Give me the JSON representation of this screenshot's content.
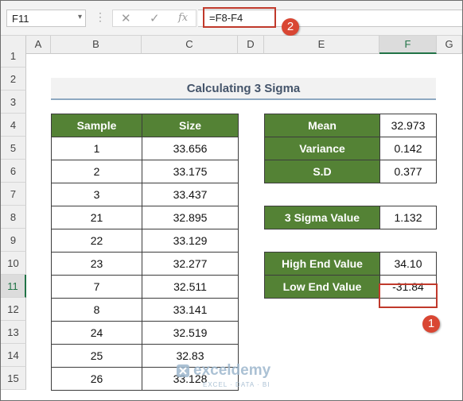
{
  "formula_bar": {
    "name_box": "F11",
    "name_box_arrow": "▾",
    "dots": "⋮",
    "cancel_glyph": "✕",
    "enter_glyph": "✓",
    "fx_glyph": "fx",
    "formula": "=F8-F4"
  },
  "badges": {
    "formula": "2",
    "cell": "1"
  },
  "columns": [
    "A",
    "B",
    "C",
    "D",
    "E",
    "F",
    "G"
  ],
  "selected_column": "F",
  "rows": [
    "1",
    "2",
    "3",
    "4",
    "5",
    "6",
    "7",
    "8",
    "9",
    "10",
    "11",
    "12",
    "13",
    "14",
    "15"
  ],
  "selected_row": "11",
  "title": "Calculating 3 Sigma",
  "sample_table": {
    "headers": [
      "Sample",
      "Size"
    ],
    "rows": [
      [
        "1",
        "33.656"
      ],
      [
        "2",
        "33.175"
      ],
      [
        "3",
        "33.437"
      ],
      [
        "21",
        "32.895"
      ],
      [
        "22",
        "33.129"
      ],
      [
        "23",
        "32.277"
      ],
      [
        "7",
        "32.511"
      ],
      [
        "8",
        "33.141"
      ],
      [
        "24",
        "32.519"
      ],
      [
        "25",
        "32.83"
      ],
      [
        "26",
        "33.128"
      ]
    ]
  },
  "stats": [
    {
      "label": "Mean",
      "value": "32.973"
    },
    {
      "label": "Variance",
      "value": "0.142"
    },
    {
      "label": "S.D",
      "value": "0.377"
    }
  ],
  "sigma": {
    "label": "3 Sigma Value",
    "value": "1.132"
  },
  "bounds": [
    {
      "label": "High End Value",
      "value": "34.10"
    },
    {
      "label": "Low End Value",
      "value": "-31.84"
    }
  ],
  "watermark": {
    "name": "exceldemy",
    "tag": "EXCEL · DATA · BI"
  },
  "colors": {
    "header_green": "#548235",
    "selection_green": "#217346",
    "highlight_red": "#c0392b"
  }
}
